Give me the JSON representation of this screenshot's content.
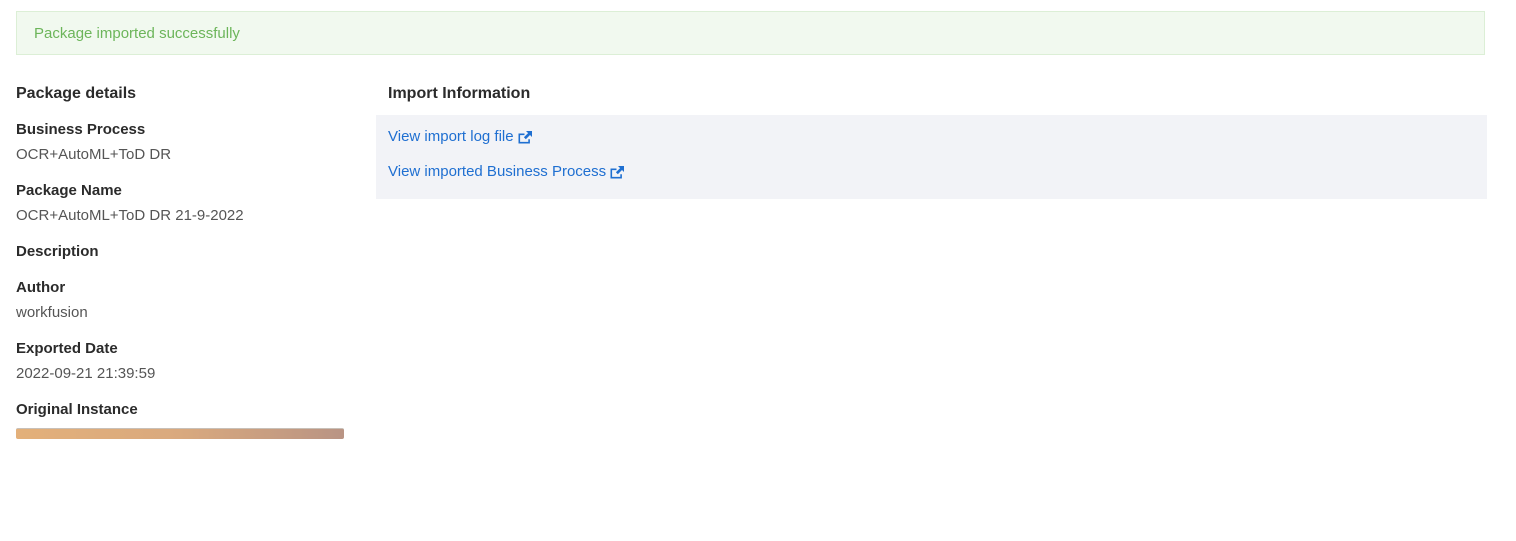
{
  "alert": {
    "message": "Package imported successfully"
  },
  "package_details": {
    "title": "Package details",
    "fields": [
      {
        "label": "Business Process",
        "value": "OCR+AutoML+ToD DR"
      },
      {
        "label": "Package Name",
        "value": "OCR+AutoML+ToD DR 21-9-2022"
      },
      {
        "label": "Description",
        "value": ""
      },
      {
        "label": "Author",
        "value": "workfusion"
      },
      {
        "label": "Exported Date",
        "value": "2022-09-21 21:39:59"
      },
      {
        "label": "Original Instance",
        "value": ""
      }
    ]
  },
  "import_information": {
    "title": "Import Information",
    "links": [
      {
        "label": "View import log file",
        "icon": "external-link-icon"
      },
      {
        "label": "View imported Business Process",
        "icon": "external-link-icon"
      }
    ]
  },
  "colors": {
    "alert_bg": "#f1f9ef",
    "alert_text": "#6cb55a",
    "link": "#1f6fd1",
    "info_box_bg": "#f2f3f7"
  }
}
